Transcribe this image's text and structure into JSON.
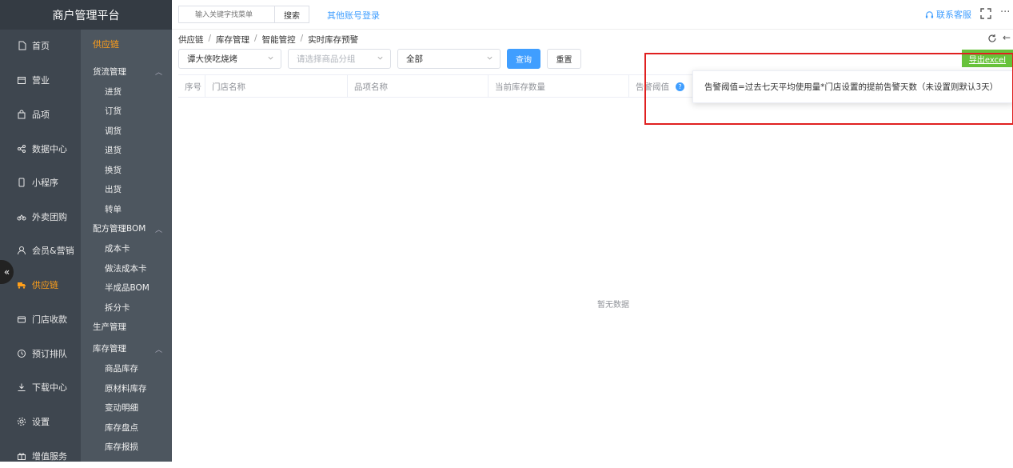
{
  "app": {
    "title": "商户管理平台"
  },
  "header": {
    "search_placeholder": "输入关键字找菜单",
    "search_button": "搜索",
    "other_account_login": "其他账号登录",
    "support": "联系客服",
    "more": "···"
  },
  "primary_nav": [
    {
      "label": "首页",
      "icon": "file-icon"
    },
    {
      "label": "营业",
      "icon": "calendar-icon"
    },
    {
      "label": "品项",
      "icon": "bag-icon"
    },
    {
      "label": "数据中心",
      "icon": "share-icon"
    },
    {
      "label": "小程序",
      "icon": "phone-icon"
    },
    {
      "label": "外卖团购",
      "icon": "bike-icon"
    },
    {
      "label": "会员&营销",
      "icon": "user-icon"
    },
    {
      "label": "供应链",
      "icon": "truck-icon",
      "active": true
    },
    {
      "label": "门店收款",
      "icon": "wallet-icon"
    },
    {
      "label": "预订排队",
      "icon": "clock-icon"
    },
    {
      "label": "下载中心",
      "icon": "download-icon"
    },
    {
      "label": "设置",
      "icon": "gear-icon"
    },
    {
      "label": "增值服务",
      "icon": "gift-icon"
    }
  ],
  "secondary_nav": {
    "title": "供应链",
    "groups": [
      {
        "label": "货流管理",
        "items": [
          "进货",
          "订货",
          "调货",
          "退货",
          "换货",
          "出货",
          "转单"
        ]
      },
      {
        "label": "配方管理BOM",
        "items": [
          "成本卡",
          "做法成本卡",
          "半成品BOM",
          "拆分卡"
        ]
      },
      {
        "label": "生产管理",
        "items": []
      },
      {
        "label": "库存管理",
        "items": [
          "商品库存",
          "原材料库存",
          "变动明细",
          "库存盘点",
          "库存报损"
        ]
      }
    ]
  },
  "breadcrumb": [
    "供应链",
    "库存管理",
    "智能管控",
    "实时库存预警"
  ],
  "filters": {
    "store": "谭大侠吃烧烤",
    "category_placeholder": "请选择商品分组",
    "status": "全部",
    "query_button": "查询",
    "reset_button": "重置",
    "export_button": "导出excel"
  },
  "table": {
    "columns": [
      "序号",
      "门店名称",
      "品项名称",
      "当前库存数量",
      "告警阈值"
    ],
    "empty_text": "暂无数据"
  },
  "tooltip": "告警阈值=过去七天平均使用量*门店设置的提前告警天数（未设置则默认3天）",
  "colors": {
    "accent": "#409eff",
    "active_nav": "#ff9f1a",
    "export": "#67c23a",
    "highlight": "#e02020"
  }
}
